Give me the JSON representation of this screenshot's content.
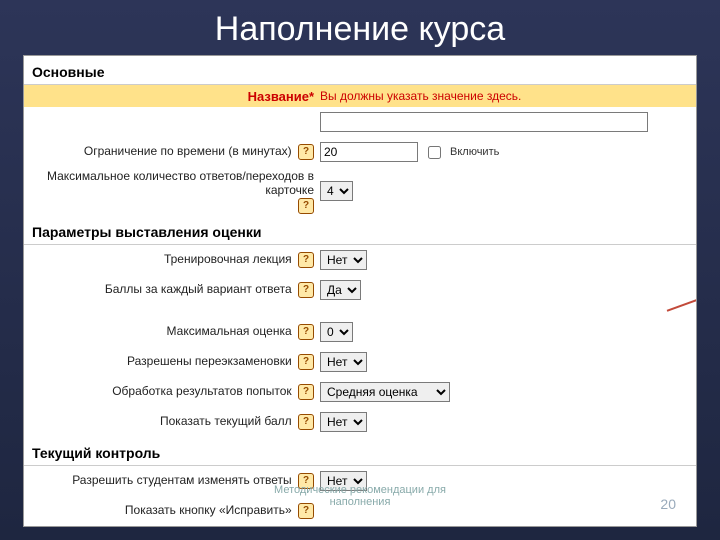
{
  "slide": {
    "title": "Наполнение курса",
    "footer_note_1": "Методические рекомендации для",
    "footer_note_2": "наполнения",
    "page_number": "20"
  },
  "sections": {
    "main": "Основные",
    "grading": "Параметры выставления оценки",
    "flow": "Текущий контроль"
  },
  "main": {
    "name_label": "Название*",
    "name_error": "Вы должны указать значение здесь.",
    "name_value": "",
    "timelimit_label": "Ограничение по времени (в минутах)",
    "timelimit_value": "20",
    "timelimit_enable": "Включить",
    "maxanswers_label": "Максимальное количество ответов/переходов в карточке",
    "maxanswers_value": "4"
  },
  "grading": {
    "practice_label": "Тренировочная лекция",
    "practice_value": "Нет",
    "custom_label": "Баллы за каждый вариант ответа",
    "custom_value": "Да",
    "maxgrade_label": "Максимальная оценка",
    "maxgrade_value": "0",
    "retake_label": "Разрешены переэкзаменовки",
    "retake_value": "Нет",
    "handling_label": "Обработка результатов попыток",
    "handling_value": "Средняя оценка",
    "ongoing_label": "Показать текущий балл",
    "ongoing_value": "Нет"
  },
  "flow": {
    "modattempts_label": "Разрешить студентам изменять ответы",
    "modattempts_value": "Нет",
    "review_label": "Показать кнопку «Исправить»"
  }
}
